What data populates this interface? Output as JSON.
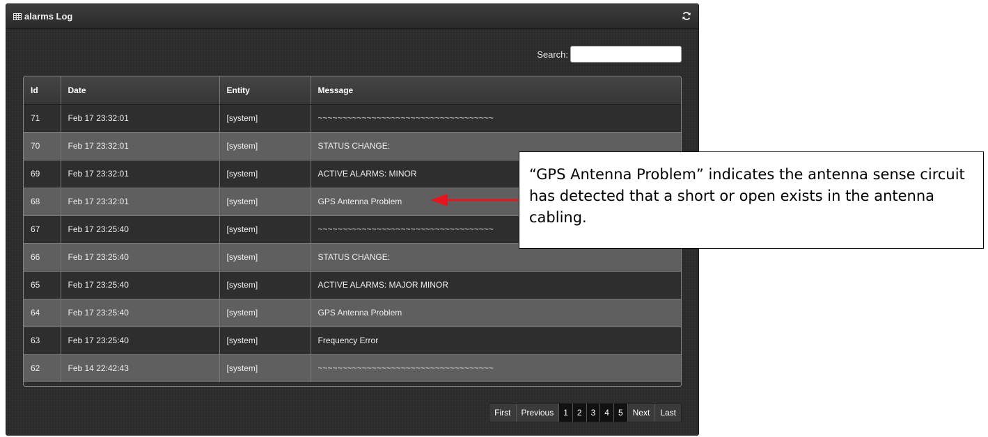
{
  "panel": {
    "title": "alarms Log"
  },
  "search": {
    "label": "Search:",
    "value": "",
    "placeholder": ""
  },
  "table": {
    "columns": [
      "Id",
      "Date",
      "Entity",
      "Message"
    ],
    "rows": [
      [
        "71",
        "Feb 17 23:32:01",
        "[system]",
        "~~~~~~~~~~~~~~~~~~~~~~~~~~~~~~~~~~~~"
      ],
      [
        "70",
        "Feb 17 23:32:01",
        "[system]",
        "STATUS CHANGE:"
      ],
      [
        "69",
        "Feb 17 23:32:01",
        "[system]",
        "ACTIVE ALARMS: MINOR"
      ],
      [
        "68",
        "Feb 17 23:32:01",
        "[system]",
        "GPS Antenna Problem"
      ],
      [
        "67",
        "Feb 17 23:25:40",
        "[system]",
        "~~~~~~~~~~~~~~~~~~~~~~~~~~~~~~~~~~~~"
      ],
      [
        "66",
        "Feb 17 23:25:40",
        "[system]",
        "STATUS CHANGE:"
      ],
      [
        "65",
        "Feb 17 23:25:40",
        "[system]",
        "ACTIVE ALARMS: MAJOR MINOR"
      ],
      [
        "64",
        "Feb 17 23:25:40",
        "[system]",
        "GPS Antenna Problem"
      ],
      [
        "63",
        "Feb 17 23:25:40",
        "[system]",
        "Frequency Error"
      ],
      [
        "62",
        "Feb 14 22:42:43",
        "[system]",
        "~~~~~~~~~~~~~~~~~~~~~~~~~~~~~~~~~~~~"
      ]
    ]
  },
  "pagination": [
    "First",
    "Previous",
    "1",
    "2",
    "3",
    "4",
    "5",
    "Next",
    "Last"
  ],
  "callout": {
    "text": "“GPS Antenna Problem” indicates the antenna sense circuit has detected that a short or open exists in the antenna cabling."
  },
  "icons": {
    "title": "grid-icon",
    "refresh": "refresh-icon",
    "annotation": "arrow-left-icon"
  },
  "colors": {
    "arrow": "#e8141b",
    "panel": "#2c2c2c"
  }
}
